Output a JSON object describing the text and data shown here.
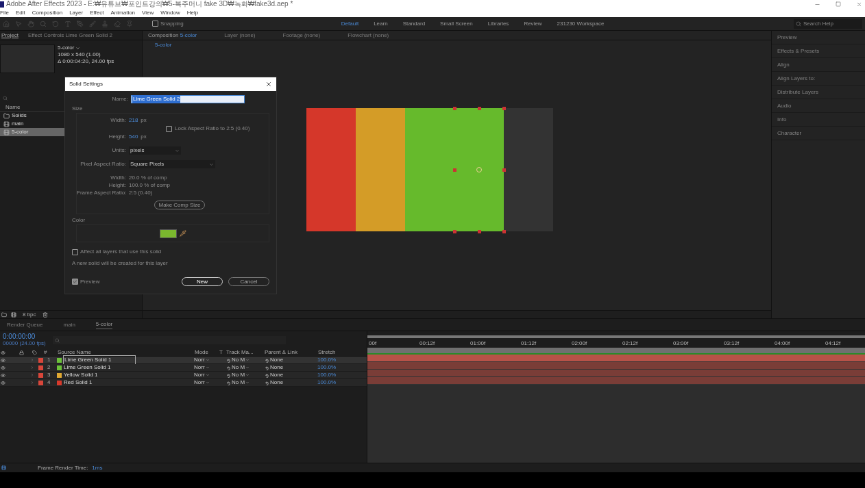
{
  "window": {
    "title": "Adobe After Effects 2023 - E:₩유튜브₩포인트강의₩5-복주머니 fake 3D₩녹화₩fake3d.aep *",
    "menu": [
      "File",
      "Edit",
      "Composition",
      "Layer",
      "Effect",
      "Animation",
      "View",
      "Window",
      "Help"
    ]
  },
  "toolbar": {
    "snapping": {
      "label": "Snapping",
      "checked": false
    },
    "workspaces": [
      {
        "label": "Default",
        "selected": true
      },
      {
        "label": "Learn",
        "selected": false
      },
      {
        "label": "Standard",
        "selected": false
      },
      {
        "label": "Small Screen",
        "selected": false
      },
      {
        "label": "Libraries",
        "selected": false
      },
      {
        "label": "Review",
        "selected": false
      },
      {
        "label": "231230 Workspace",
        "selected": false
      }
    ],
    "search_placeholder": "Search Help"
  },
  "project_panel": {
    "tabs": [
      {
        "label": "Project",
        "selected": true
      },
      {
        "label": "Effect Controls Lime Green Solid 2",
        "selected": false
      }
    ],
    "comp_name": "5-color",
    "comp_size": "1080 x 540 (1.00)",
    "comp_duration": "Δ 0:00:04:20, 24.00 fps",
    "column": "Name",
    "items": [
      {
        "name": "Solids",
        "kind": "folder",
        "selected": false
      },
      {
        "name": "main",
        "kind": "comp",
        "selected": false
      },
      {
        "name": "5-color",
        "kind": "comp",
        "selected": true
      }
    ],
    "bpc": "8 bpc"
  },
  "viewer": {
    "tabs": [
      {
        "label": "Composition",
        "comp": "5-color",
        "selected": true
      },
      {
        "label": "Layer (none)",
        "selected": false
      },
      {
        "label": "Footage (none)",
        "selected": false
      },
      {
        "label": "Flowchart (none)",
        "selected": false
      }
    ],
    "breadcrumb": "5-color",
    "solids": [
      {
        "color": "#d5372a",
        "selected": false
      },
      {
        "color": "#d49c27",
        "selected": false
      },
      {
        "color": "#66ba2c",
        "selected": false
      },
      {
        "color": "#66ba2c",
        "selected": true
      }
    ]
  },
  "right_panels": [
    "Preview",
    "Effects & Presets",
    "Align",
    "Align Layers to:",
    "Distribute Layers",
    "Audio",
    "Info",
    "Character"
  ],
  "dialog": {
    "title": "Solid Settings",
    "name_label": "Name:",
    "name_value": "Lime Green Solid 2",
    "size_label": "Size",
    "width_label": "Width:",
    "width_value": "218",
    "width_unit": "px",
    "height_label": "Height:",
    "height_value": "540",
    "height_unit": "px",
    "lock": {
      "label": "Lock Aspect Ratio to 2:5 (0.40)",
      "checked": false
    },
    "units_label": "Units:",
    "units_value": "pixels",
    "par_label": "Pixel Aspect Ratio:",
    "par_value": "Square Pixels",
    "info": [
      {
        "label": "Width:",
        "value": "20.0 % of comp"
      },
      {
        "label": "Height:",
        "value": "100.0 % of comp"
      },
      {
        "label": "Frame Aspect Ratio:",
        "value": "2:5 (0.40)"
      }
    ],
    "make_comp_size": "Make Comp Size",
    "color_label": "Color",
    "color_swatch": {
      "color": "#7ab82e"
    },
    "affect": {
      "label": "Affect all layers that use this solid",
      "checked": false
    },
    "note": "A new solid will be created for this layer",
    "preview": {
      "label": "Preview",
      "checked": true
    },
    "ok": "New",
    "cancel": "Cancel"
  },
  "timeline": {
    "tabs": [
      {
        "label": "Render Queue",
        "selected": false
      },
      {
        "label": "main",
        "selected": false
      },
      {
        "label": "5-color",
        "selected": true
      }
    ],
    "timecode": "0:00:00:00",
    "fps": "00000 (24.00 fps)",
    "columns": {
      "num": "#",
      "source": "Source Name",
      "mode": "Mode",
      "t": "T",
      "track": "Track Ma...",
      "parent": "Parent & Link",
      "stretch": "Stretch"
    },
    "layers": [
      {
        "num": "1",
        "name": "Lime Green Solid 1",
        "color": "#6cc23a",
        "mode": "Norr",
        "track": "No M",
        "parent": "None",
        "stretch": "100.0%",
        "selected": true
      },
      {
        "num": "2",
        "name": "Lime Green Solid 1",
        "color": "#6cc23a",
        "mode": "Norr",
        "track": "No M",
        "parent": "None",
        "stretch": "100.0%",
        "selected": false
      },
      {
        "num": "3",
        "name": "Yellow Solid 1",
        "color": "#e0a832",
        "mode": "Norr",
        "track": "No M",
        "parent": "None",
        "stretch": "100.0%",
        "selected": false
      },
      {
        "num": "4",
        "name": "Red Solid 1",
        "color": "#d8392b",
        "mode": "Norr",
        "track": "No M",
        "parent": "None",
        "stretch": "100.0%",
        "selected": false
      }
    ],
    "ticks": [
      "00f",
      "00:12f",
      "01:00f",
      "01:12f",
      "02:00f",
      "02:12f",
      "03:00f",
      "03:12f",
      "04:00f",
      "04:12f"
    ],
    "render_label": "Frame Render Time:",
    "render_value": "1ms"
  }
}
